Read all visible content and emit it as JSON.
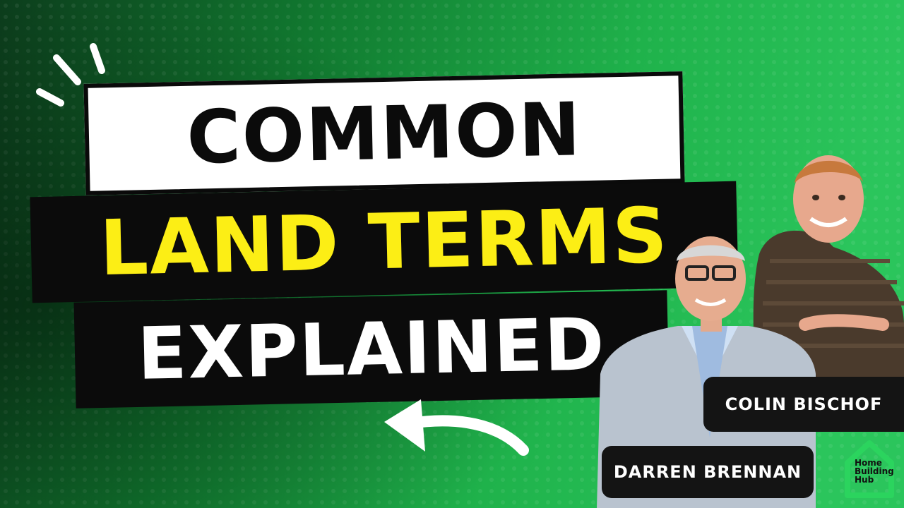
{
  "headline": {
    "line1": "COMMON",
    "line2": "LAND TERMS",
    "line3": "EXPLAINED"
  },
  "presenters": {
    "colin": "COLIN BISCHOF",
    "darren": "DARREN BRENNAN"
  },
  "logo": {
    "line1": "Home",
    "line2": "Building",
    "line3": "Hub",
    "icon": "house-outline-icon"
  },
  "colors": {
    "background_dark": "#0c3d1c",
    "background_light": "#27c25a",
    "accent_yellow": "#fcee15",
    "logo_green": "#2bd45e"
  }
}
